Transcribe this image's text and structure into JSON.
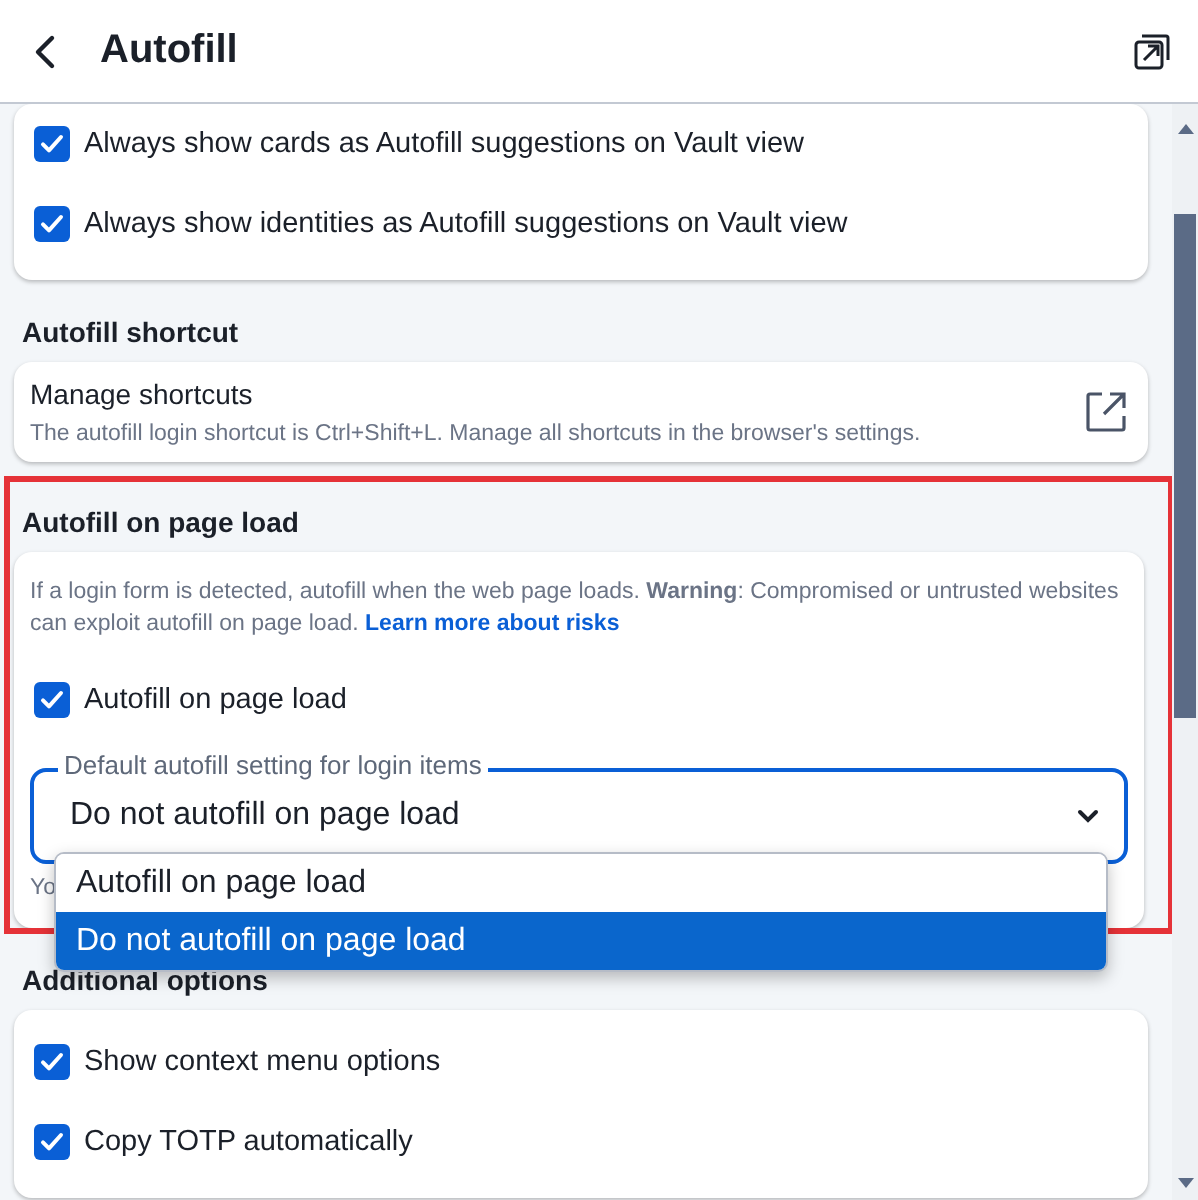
{
  "header": {
    "title": "Autofill"
  },
  "sections": [
    {
      "highlighted": false,
      "items": [
        {
          "kind": "checkbox",
          "label": "Always show cards as Autofill suggestions on Vault view",
          "checked": true
        },
        {
          "kind": "checkbox",
          "label": "Always show identities as Autofill suggestions on Vault view",
          "checked": true
        }
      ]
    },
    {
      "heading": "Autofill shortcut",
      "highlighted": false,
      "items": [
        {
          "kind": "link_row",
          "label": "Manage shortcuts",
          "hint": "The autofill login shortcut is Ctrl+Shift+L. Manage all shortcuts in the browser's settings."
        }
      ]
    },
    {
      "heading": "Autofill on page load",
      "highlighted": true,
      "items": [
        {
          "kind": "description",
          "text": "If a login form is detected, autofill when the web page loads. **Warning**: Compromised or untrusted websites can exploit autofill on page load.",
          "link": "Learn more about risks"
        },
        {
          "kind": "checkbox",
          "label": "Autofill on page load",
          "checked": true
        },
        {
          "kind": "select",
          "label": "Default autofill setting for login items",
          "value": "Do not autofill on page load",
          "open": true,
          "helper": "Yo",
          "options": [
            {
              "label": "Autofill on page load",
              "selected": false
            },
            {
              "label": "Do not autofill on page load",
              "selected": true
            }
          ]
        }
      ]
    },
    {
      "heading": "Additional options",
      "highlighted": false,
      "items": [
        {
          "kind": "checkbox",
          "label": "Show context menu options",
          "checked": true
        },
        {
          "kind": "checkbox",
          "label": "Copy TOTP automatically",
          "checked": true
        }
      ]
    }
  ]
}
